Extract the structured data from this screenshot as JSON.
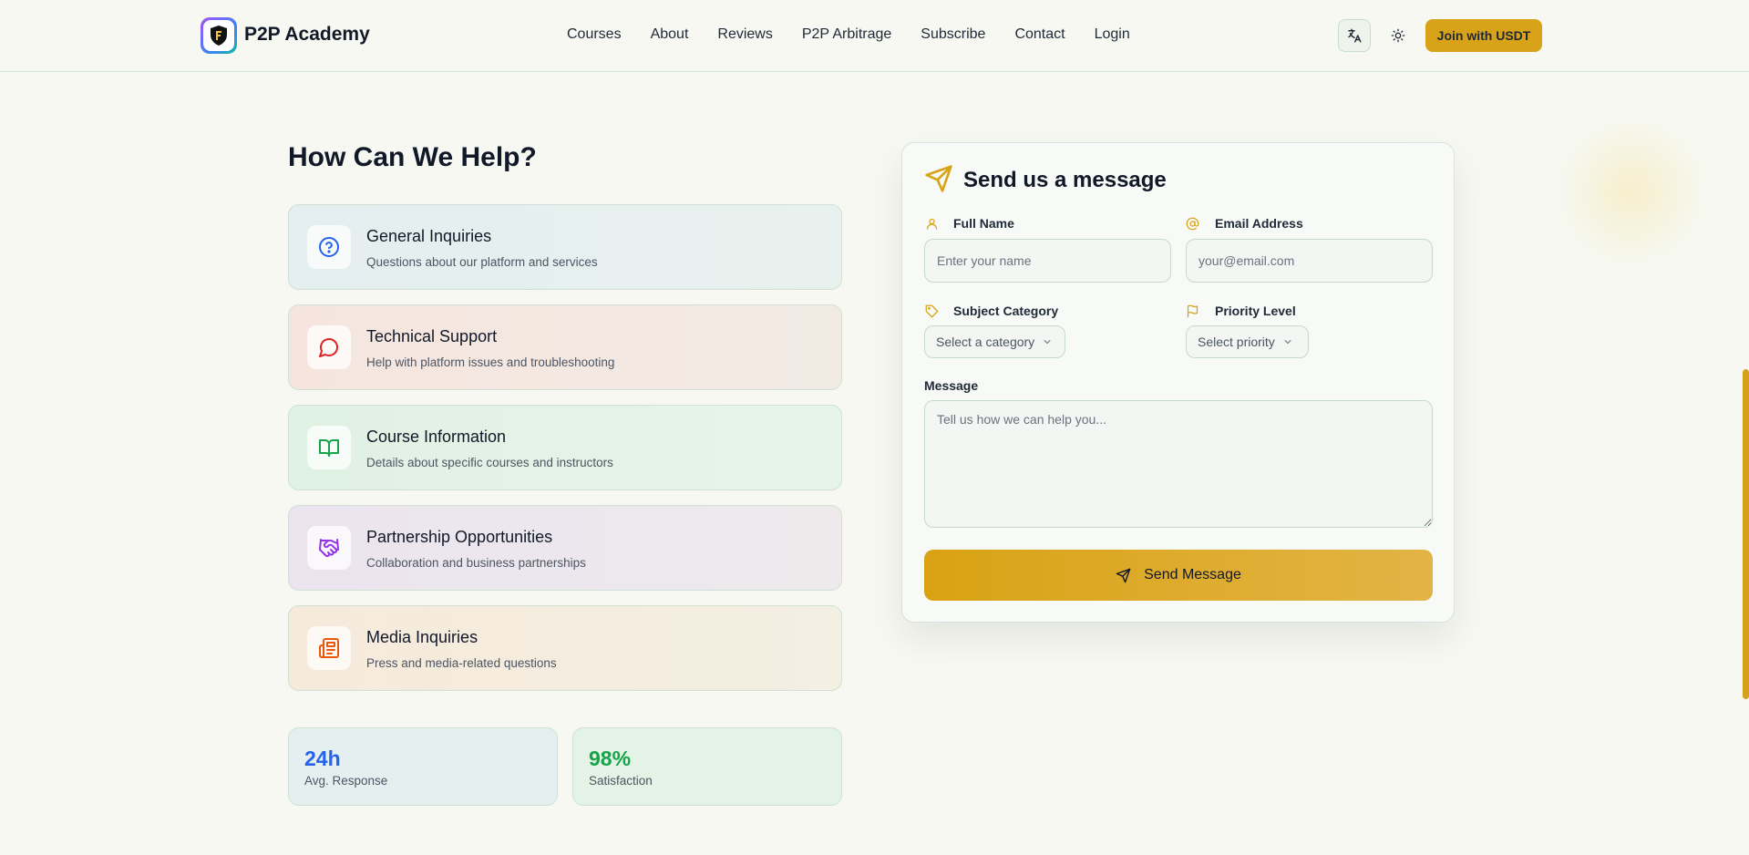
{
  "header": {
    "brand": "P2P Academy",
    "nav": [
      "Courses",
      "About",
      "Reviews",
      "P2P Arbitrage",
      "Subscribe",
      "Contact",
      "Login"
    ],
    "join_label": "Join with USDT",
    "icons": {
      "translate": "translate-icon",
      "theme": "sun-icon"
    }
  },
  "help": {
    "title": "How Can We Help?",
    "cards": [
      {
        "title": "General Inquiries",
        "subtitle": "Questions about our platform and services",
        "icon": "help-circle-icon",
        "color": "#2563eb"
      },
      {
        "title": "Technical Support",
        "subtitle": "Help with platform issues and troubleshooting",
        "icon": "message-circle-icon",
        "color": "#dc2626"
      },
      {
        "title": "Course Information",
        "subtitle": "Details about specific courses and instructors",
        "icon": "book-open-icon",
        "color": "#16a34a"
      },
      {
        "title": "Partnership Opportunities",
        "subtitle": "Collaboration and business partnerships",
        "icon": "handshake-icon",
        "color": "#9333ea"
      },
      {
        "title": "Media Inquiries",
        "subtitle": "Press and media-related questions",
        "icon": "newspaper-icon",
        "color": "#ea580c"
      }
    ],
    "stats": [
      {
        "value": "24h",
        "label": "Avg. Response",
        "color": "#2563eb"
      },
      {
        "value": "98%",
        "label": "Satisfaction",
        "color": "#16a34a"
      }
    ]
  },
  "form": {
    "title": "Send us a message",
    "full_name": {
      "label": "Full Name",
      "placeholder": "Enter your name",
      "value": ""
    },
    "email": {
      "label": "Email Address",
      "placeholder": "your@email.com",
      "value": ""
    },
    "subject": {
      "label": "Subject Category",
      "selected": "Select a category"
    },
    "priority": {
      "label": "Priority Level",
      "selected": "Select priority"
    },
    "message": {
      "label": "Message",
      "placeholder": "Tell us how we can help you...",
      "value": ""
    },
    "submit_label": "Send Message"
  },
  "colors": {
    "accent": "#d8a318",
    "background": "#f6f8f1"
  }
}
